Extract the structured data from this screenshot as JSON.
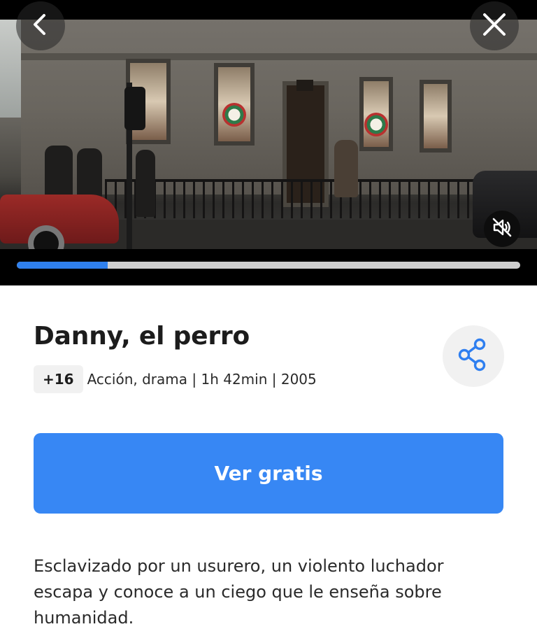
{
  "player": {
    "back_icon": "chevron-left-icon",
    "close_icon": "close-icon",
    "mute_icon": "speaker-muted-icon",
    "progress": 0.18,
    "progress_color": "#2f80ed",
    "track_color": "#cfcfcf"
  },
  "movie": {
    "title": "Danny, el perro",
    "rating": "+16",
    "meta": "Acción, drama | 1h 42min | 2005",
    "share_icon": "share-icon",
    "cta_label": "Ver gratis",
    "cta_color": "#3787f4",
    "synopsis": "Esclavizado por un usurero, un violento luchador escapa y conoce a un ciego que le enseña sobre humanidad."
  }
}
